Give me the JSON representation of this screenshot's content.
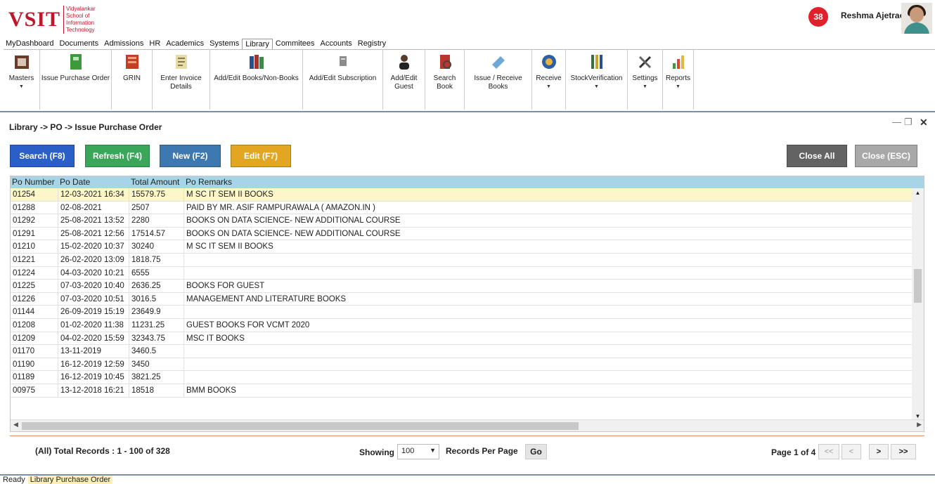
{
  "header": {
    "logo_text": "VSIT",
    "logo_subtitle": "Vidyalankar School of Information Technology",
    "notification_count": "38",
    "user_name": "Reshma Ajetrao"
  },
  "menubar": {
    "items": [
      "MyDashboard",
      "Documents",
      "Admissions",
      "HR",
      "Academics",
      "Systems",
      "Library",
      "Commitees",
      "Accounts",
      "Registry"
    ],
    "active": "Library"
  },
  "ribbon": [
    {
      "label": "Masters",
      "icon": "masters-icon",
      "dropdown": true
    },
    {
      "label": "Issue Purchase Order",
      "icon": "purchase-order-icon",
      "dropdown": false
    },
    {
      "label": "GRIN",
      "icon": "grin-icon",
      "dropdown": false
    },
    {
      "label": "Enter Invoice Details",
      "icon": "invoice-icon",
      "dropdown": false
    },
    {
      "label": "Add/Edit Books/Non-Books",
      "icon": "books-icon",
      "dropdown": false
    },
    {
      "label": "Add/Edit Subscription",
      "icon": "subscription-icon",
      "dropdown": false
    },
    {
      "label": "Add/Edit Guest",
      "icon": "guest-icon",
      "dropdown": false
    },
    {
      "label": "Search Book",
      "icon": "search-book-icon",
      "dropdown": false
    },
    {
      "label": "Issue / Receive Books",
      "icon": "issue-receive-icon",
      "dropdown": false
    },
    {
      "label": "Receive",
      "icon": "receive-icon",
      "dropdown": true
    },
    {
      "label": "StockVerification",
      "icon": "stock-verification-icon",
      "dropdown": true
    },
    {
      "label": "Settings",
      "icon": "settings-icon",
      "dropdown": true
    },
    {
      "label": "Reports",
      "icon": "reports-icon",
      "dropdown": true
    }
  ],
  "page": {
    "breadcrumb": "Library -> PO -> Issue Purchase Order",
    "minimize_icon": "minimize-icon",
    "restore_icon": "restore-icon",
    "close_icon": "close-icon"
  },
  "toolbar": {
    "search": "Search (F8)",
    "refresh": "Refresh (F4)",
    "new": "New (F2)",
    "edit": "Edit (F7)",
    "close_all": "Close All",
    "close_esc": "Close (ESC)"
  },
  "colors": {
    "search": "#2a5fc8",
    "refresh": "#3aa65a",
    "new": "#3d78b0",
    "edit": "#e2a622",
    "close_all": "#636363",
    "close_esc": "#a8a8a8",
    "header_row": "#a7d4e6",
    "selected_row": "#fcf6c8"
  },
  "table": {
    "columns": [
      "Po Number",
      "Po Date",
      "Total Amount",
      "Po Remarks"
    ],
    "rows": [
      [
        "01254",
        "12-03-2021 16:34",
        "15579.75",
        "M SC IT SEM II BOOKS"
      ],
      [
        "01288",
        "02-08-2021",
        "2507",
        "PAID BY MR. ASIF RAMPURAWALA  ( AMAZON.IN )"
      ],
      [
        "01292",
        "25-08-2021 13:52",
        "2280",
        "BOOKS ON DATA SCIENCE- NEW ADDITIONAL COURSE"
      ],
      [
        "01291",
        "25-08-2021 12:56",
        "17514.57",
        "BOOKS ON DATA SCIENCE- NEW ADDITIONAL COURSE"
      ],
      [
        "01210",
        "15-02-2020 10:37",
        "30240",
        "M SC IT SEM II BOOKS"
      ],
      [
        "01221",
        "26-02-2020 13:09",
        "1818.75",
        ""
      ],
      [
        "01224",
        "04-03-2020 10:21",
        "6555",
        ""
      ],
      [
        "01225",
        "07-03-2020 10:40",
        "2636.25",
        "BOOKS FOR GUEST"
      ],
      [
        "01226",
        "07-03-2020 10:51",
        "3016.5",
        "MANAGEMENT AND LITERATURE BOOKS"
      ],
      [
        "01144",
        "26-09-2019 15:19",
        "23649.9",
        ""
      ],
      [
        "01208",
        "01-02-2020 11:38",
        "11231.25",
        "GUEST BOOKS FOR VCMT 2020"
      ],
      [
        "01209",
        "04-02-2020 15:59",
        "32343.75",
        "MSC IT BOOKS"
      ],
      [
        "01170",
        "13-11-2019",
        "3460.5",
        ""
      ],
      [
        "01190",
        "16-12-2019 12:59",
        "3450",
        ""
      ],
      [
        "01189",
        "16-12-2019 10:45",
        "3821.25",
        ""
      ],
      [
        "00975",
        "13-12-2018 16:21",
        "18518",
        "BMM BOOKS"
      ]
    ],
    "selected_row": 0
  },
  "footer": {
    "records": "(All) Total Records : 1 - 100 of 328",
    "showing": "Showing",
    "per_page_value": "100",
    "records_per_page": "Records Per Page",
    "go": "Go",
    "page_info": "Page 1 of 4",
    "first": "<<",
    "prev": "<",
    "next": ">",
    "last": ">>"
  },
  "status": {
    "ready": "Ready",
    "module": "Library Purchase Order"
  }
}
